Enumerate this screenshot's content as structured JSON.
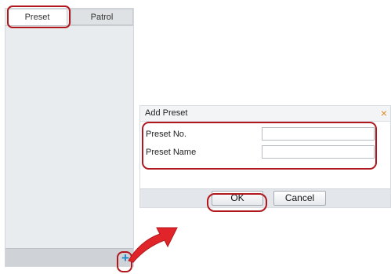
{
  "left_panel": {
    "tabs": [
      {
        "label": "Preset",
        "active": true
      },
      {
        "label": "Patrol",
        "active": false
      }
    ],
    "add_button_symbol": "+",
    "add_icon": "plus-icon"
  },
  "dialog": {
    "title": "Add Preset",
    "close_symbol": "×",
    "close_icon": "close-icon",
    "fields": [
      {
        "label": "Preset No.",
        "value": ""
      },
      {
        "label": "Preset Name",
        "value": ""
      }
    ],
    "ok_label": "OK",
    "cancel_label": "Cancel"
  },
  "colors": {
    "highlight": "#b0181e",
    "arrow": "#e0242a",
    "add_icon": "#1e88c8",
    "close_icon": "#e08a24"
  }
}
